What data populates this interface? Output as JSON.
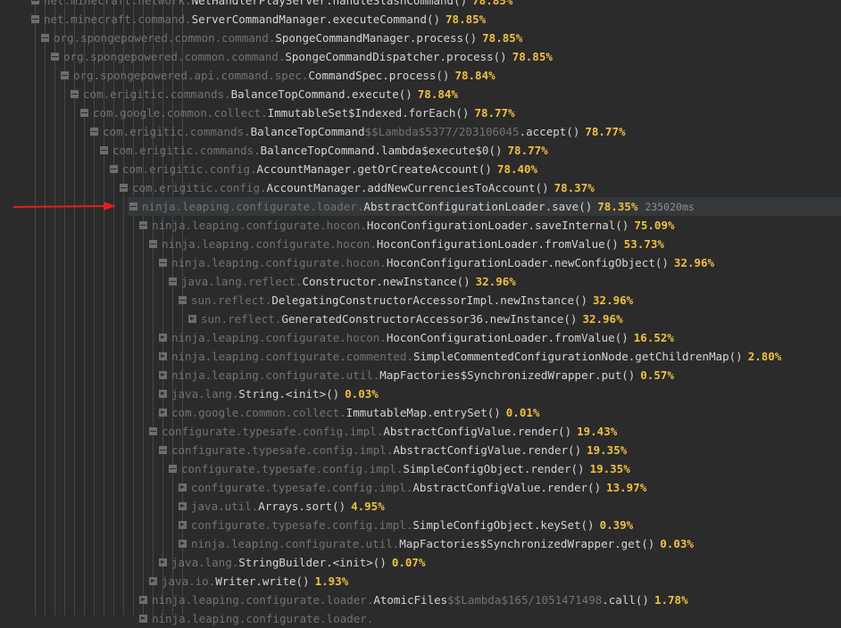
{
  "colors": {
    "background": "#2b2b2b",
    "package_text": "#6e7478",
    "class_text": "#d4d4d4",
    "percent_text": "#f0c040",
    "selected_row": "#35383a",
    "arrow": "#e0201c"
  },
  "rows": [
    {
      "level": 0,
      "toggle": "expanded",
      "pkg": "net.minecraft.network.",
      "cls": "NetHandlerPlayServer",
      "mid": "",
      "method": ".handleSlashCommand()",
      "pct": "78.85%"
    },
    {
      "level": 0,
      "toggle": "expanded",
      "pkg": "net.minecraft.command.",
      "cls": "ServerCommandManager",
      "mid": "",
      "method": ".executeCommand()",
      "pct": "78.85%"
    },
    {
      "level": 1,
      "toggle": "expanded",
      "pkg": "org.spongepowered.common.command.",
      "cls": "SpongeCommandManager",
      "mid": "",
      "method": ".process()",
      "pct": "78.85%"
    },
    {
      "level": 2,
      "toggle": "expanded",
      "pkg": "org.spongepowered.common.command.",
      "cls": "SpongeCommandDispatcher",
      "mid": "",
      "method": ".process()",
      "pct": "78.85%"
    },
    {
      "level": 3,
      "toggle": "expanded",
      "pkg": "org.spongepowered.api.command.spec.",
      "cls": "CommandSpec",
      "mid": "",
      "method": ".process()",
      "pct": "78.84%"
    },
    {
      "level": 4,
      "toggle": "expanded",
      "pkg": "com.erigitic.commands.",
      "cls": "BalanceTopCommand",
      "mid": "",
      "method": ".execute()",
      "pct": "78.84%"
    },
    {
      "level": 5,
      "toggle": "expanded",
      "pkg": "com.google.common.collect.",
      "cls": "ImmutableSet$Indexed",
      "mid": "",
      "method": ".forEach()",
      "pct": "78.77%"
    },
    {
      "level": 6,
      "toggle": "expanded",
      "pkg": "com.erigitic.commands.",
      "cls": "BalanceTopCommand",
      "mid": "$$Lambda$5377/203106045",
      "method": ".accept()",
      "pct": "78.77%"
    },
    {
      "level": 7,
      "toggle": "expanded",
      "pkg": "com.erigitic.commands.",
      "cls": "BalanceTopCommand",
      "mid": "",
      "method": ".lambda$execute$0()",
      "pct": "78.77%"
    },
    {
      "level": 8,
      "toggle": "expanded",
      "pkg": "com.erigitic.config.",
      "cls": "AccountManager",
      "mid": "",
      "method": ".getOrCreateAccount()",
      "pct": "78.40%"
    },
    {
      "level": 9,
      "toggle": "expanded",
      "pkg": "com.erigitic.config.",
      "cls": "AccountManager",
      "mid": "",
      "method": ".addNewCurrenciesToAccount()",
      "pct": "78.37%"
    },
    {
      "level": 10,
      "toggle": "expanded",
      "pkg": "ninja.leaping.configurate.loader.",
      "cls": "AbstractConfigurationLoader",
      "mid": "",
      "method": ".save()",
      "pct": "78.35%",
      "time": "235020ms",
      "selected": true
    },
    {
      "level": 11,
      "toggle": "expanded",
      "pkg": "ninja.leaping.configurate.hocon.",
      "cls": "HoconConfigurationLoader",
      "mid": "",
      "method": ".saveInternal()",
      "pct": "75.09%"
    },
    {
      "level": 12,
      "toggle": "expanded",
      "pkg": "ninja.leaping.configurate.hocon.",
      "cls": "HoconConfigurationLoader",
      "mid": "",
      "method": ".fromValue()",
      "pct": "53.73%"
    },
    {
      "level": 13,
      "toggle": "expanded",
      "pkg": "ninja.leaping.configurate.hocon.",
      "cls": "HoconConfigurationLoader",
      "mid": "",
      "method": ".newConfigObject()",
      "pct": "32.96%"
    },
    {
      "level": 14,
      "toggle": "expanded",
      "pkg": "java.lang.reflect.",
      "cls": "Constructor",
      "mid": "",
      "method": ".newInstance()",
      "pct": "32.96%"
    },
    {
      "level": 15,
      "toggle": "expanded",
      "pkg": "sun.reflect.",
      "cls": "DelegatingConstructorAccessorImpl",
      "mid": "",
      "method": ".newInstance()",
      "pct": "32.96%"
    },
    {
      "level": 16,
      "toggle": "collapsed",
      "pkg": "sun.reflect.",
      "cls": "GeneratedConstructorAccessor36",
      "mid": "",
      "method": ".newInstance()",
      "pct": "32.96%"
    },
    {
      "level": 13,
      "toggle": "collapsed",
      "pkg": "ninja.leaping.configurate.hocon.",
      "cls": "HoconConfigurationLoader",
      "mid": "",
      "method": ".fromValue()",
      "pct": "16.52%"
    },
    {
      "level": 13,
      "toggle": "collapsed",
      "pkg": "ninja.leaping.configurate.commented.",
      "cls": "SimpleCommentedConfigurationNode",
      "mid": "",
      "method": ".getChildrenMap()",
      "pct": "2.80%"
    },
    {
      "level": 13,
      "toggle": "collapsed",
      "pkg": "ninja.leaping.configurate.util.",
      "cls": "MapFactories$SynchronizedWrapper",
      "mid": "",
      "method": ".put()",
      "pct": "0.57%"
    },
    {
      "level": 13,
      "toggle": "collapsed",
      "pkg": "java.lang.",
      "cls": "String",
      "mid": "",
      "method": ".<init>()",
      "pct": "0.03%"
    },
    {
      "level": 13,
      "toggle": "collapsed",
      "pkg": "com.google.common.collect.",
      "cls": "ImmutableMap",
      "mid": "",
      "method": ".entrySet()",
      "pct": "0.01%"
    },
    {
      "level": 12,
      "toggle": "expanded",
      "pkg": "configurate.typesafe.config.impl.",
      "cls": "AbstractConfigValue",
      "mid": "",
      "method": ".render()",
      "pct": "19.43%"
    },
    {
      "level": 13,
      "toggle": "expanded",
      "pkg": "configurate.typesafe.config.impl.",
      "cls": "AbstractConfigValue",
      "mid": "",
      "method": ".render()",
      "pct": "19.35%"
    },
    {
      "level": 14,
      "toggle": "expanded",
      "pkg": "configurate.typesafe.config.impl.",
      "cls": "SimpleConfigObject",
      "mid": "",
      "method": ".render()",
      "pct": "19.35%"
    },
    {
      "level": 15,
      "toggle": "collapsed",
      "pkg": "configurate.typesafe.config.impl.",
      "cls": "AbstractConfigValue",
      "mid": "",
      "method": ".render()",
      "pct": "13.97%"
    },
    {
      "level": 15,
      "toggle": "collapsed",
      "pkg": "java.util.",
      "cls": "Arrays",
      "mid": "",
      "method": ".sort()",
      "pct": "4.95%"
    },
    {
      "level": 15,
      "toggle": "collapsed",
      "pkg": "configurate.typesafe.config.impl.",
      "cls": "SimpleConfigObject",
      "mid": "",
      "method": ".keySet()",
      "pct": "0.39%"
    },
    {
      "level": 15,
      "toggle": "collapsed",
      "pkg": "ninja.leaping.configurate.util.",
      "cls": "MapFactories$SynchronizedWrapper",
      "mid": "",
      "method": ".get()",
      "pct": "0.03%"
    },
    {
      "level": 13,
      "toggle": "collapsed",
      "pkg": "java.lang.",
      "cls": "StringBuilder",
      "mid": "",
      "method": ".<init>()",
      "pct": "0.07%"
    },
    {
      "level": 12,
      "toggle": "collapsed",
      "pkg": "java.io.",
      "cls": "Writer",
      "mid": "",
      "method": ".write()",
      "pct": "1.93%"
    },
    {
      "level": 11,
      "toggle": "collapsed",
      "pkg": "ninja.leaping.configurate.loader.",
      "cls": "AtomicFiles",
      "mid": "$$Lambda$165/1051471498",
      "method": ".call()",
      "pct": "1.78%"
    },
    {
      "level": 11,
      "toggle": "collapsed",
      "pkg": "ninja.leaping.configurate.loader.",
      "cls": "",
      "mid": "",
      "method": "",
      "pct": ""
    }
  ]
}
